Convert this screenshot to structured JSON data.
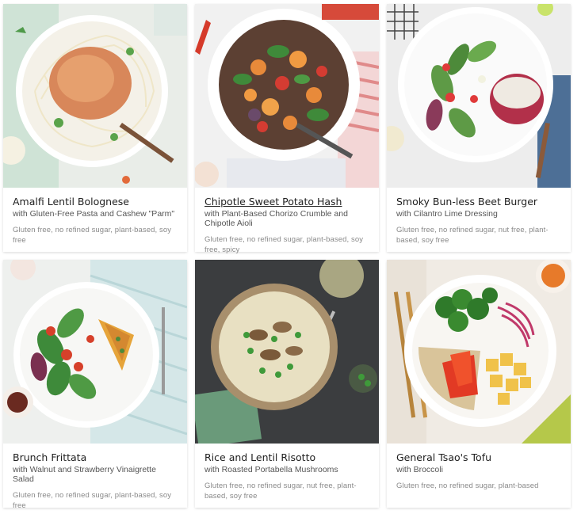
{
  "recipes": [
    {
      "title": "Amalfi Lentil Bolognese",
      "subtitle": "with Gluten-Free Pasta and Cashew \"Parm\"",
      "tags": "Gluten free, no refined sugar, plant-based, soy free",
      "image_alt": "Lentil bolognese over pasta in a white bowl"
    },
    {
      "title": "Chipotle Sweet Potato Hash",
      "subtitle": "with Plant-Based Chorizo Crumble and Chipotle Aioli",
      "tags": "Gluten free, no refined sugar, plant-based, soy free, spicy",
      "image_alt": "Sweet potato hash with greens in a white bowl"
    },
    {
      "title": "Smoky Bun-less Beet Burger",
      "subtitle": "with Cilantro Lime Dressing",
      "tags": "Gluten free, no refined sugar, nut free, plant-based, soy free",
      "image_alt": "Beet burger with salad on a white plate"
    },
    {
      "title": "Brunch Frittata",
      "subtitle": "with Walnut and Strawberry Vinaigrette Salad",
      "tags": "Gluten free, no refined sugar, plant-based, soy free",
      "image_alt": "Frittata slice with salad on a plate"
    },
    {
      "title": "Rice and Lentil Risotto",
      "subtitle": "with Roasted Portabella Mushrooms",
      "tags": "Gluten free, no refined sugar, nut free, plant-based, soy free",
      "image_alt": "Risotto with mushrooms and peas in a bowl"
    },
    {
      "title": "General Tsao's Tofu",
      "subtitle": "with Broccoli",
      "tags": "Gluten free, no refined sugar, plant-based",
      "image_alt": "Tofu, broccoli, peppers and rice in a bowl"
    }
  ],
  "colors": {
    "title": "#1f1f1f",
    "subtitle": "#555555",
    "tags": "#8a8a8a"
  }
}
